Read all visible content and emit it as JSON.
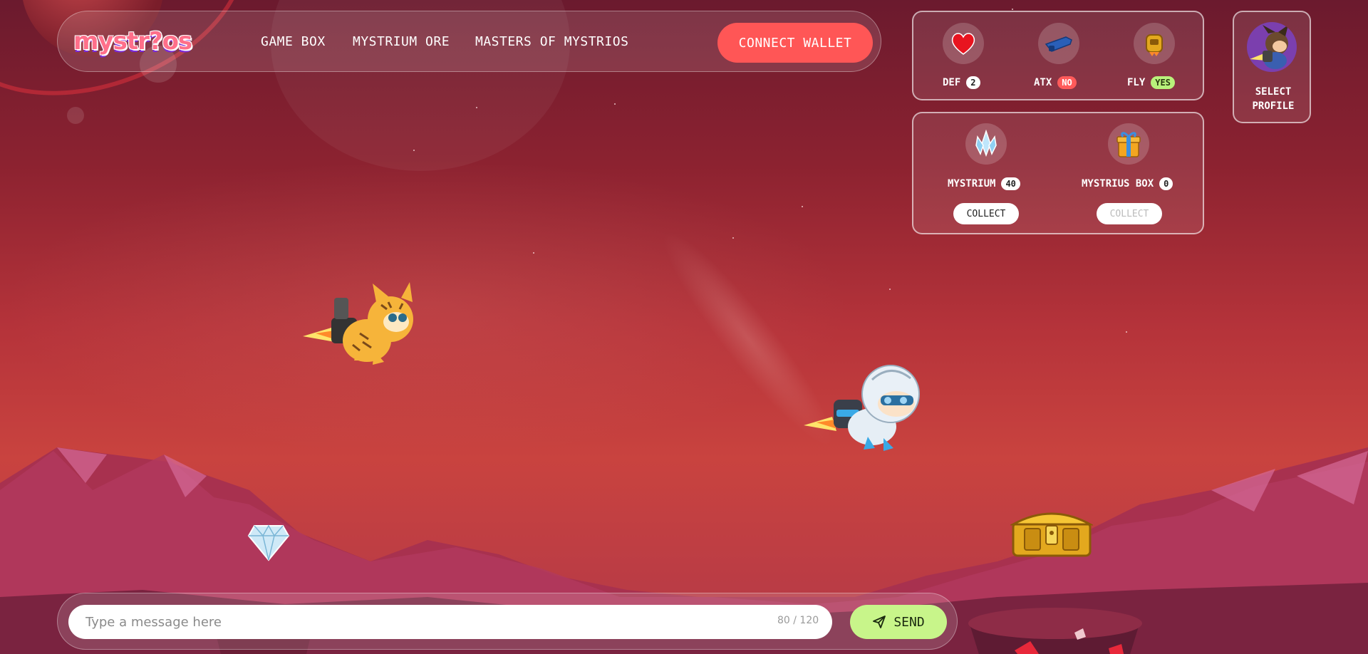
{
  "logo": {
    "text": "mystr?os"
  },
  "nav": {
    "links": [
      "GAME BOX",
      "MYSTRIUM ORE",
      "MASTERS OF MYSTRIOS"
    ],
    "connect_label": "CONNECT WALLET"
  },
  "stats": [
    {
      "label": "DEF",
      "value": "2",
      "icon": "heart-icon"
    },
    {
      "label": "ATX",
      "value": "NO",
      "icon": "blaster-icon"
    },
    {
      "label": "FLY",
      "value": "YES",
      "icon": "jetpack-icon"
    }
  ],
  "resources": [
    {
      "label": "MYSTRIUM",
      "value": "40",
      "icon": "crystal-icon",
      "collect_label": "COLLECT",
      "collect_enabled": true
    },
    {
      "label": "MYSTRIUS BOX",
      "value": "0",
      "icon": "gift-icon",
      "collect_label": "COLLECT",
      "collect_enabled": false
    }
  ],
  "profile": {
    "label": "SELECT PROFILE",
    "icon": "profile-avatar-icon"
  },
  "chat": {
    "placeholder": "Type a message here",
    "char_count": "80 / 120",
    "send_label": "SEND"
  },
  "colors": {
    "accent_red": "#ff5656",
    "send_green": "#c8f58a",
    "pill_no": "#ff5a5a",
    "pill_yes": "#b9f27b"
  }
}
